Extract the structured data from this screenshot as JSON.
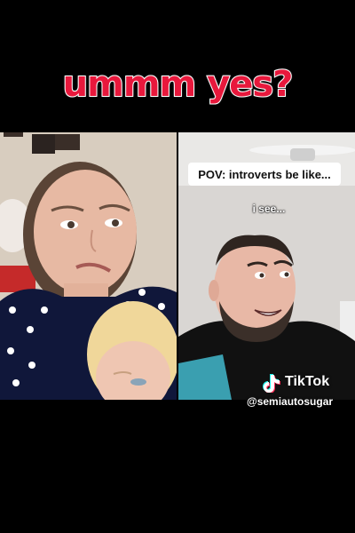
{
  "caption": {
    "text": "ummm yes?",
    "color": "#e8183c"
  },
  "right_video": {
    "banner_text": "POV: introverts be like...",
    "overlay_text": "i see..."
  },
  "watermark": {
    "brand": "TikTok",
    "username": "@semiautosugar",
    "icon": "tiktok-note-icon"
  }
}
